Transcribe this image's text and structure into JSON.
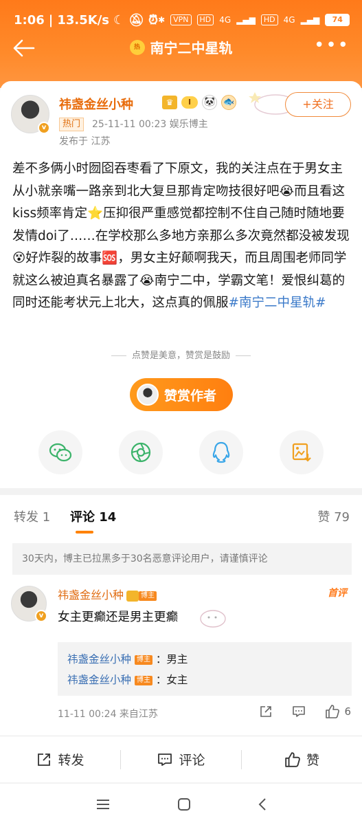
{
  "status_bar": {
    "time": "1:06",
    "speed": "13.5K/s",
    "vpn": "VPN",
    "hd1": "HD",
    "net1": "4G",
    "hd2": "HD",
    "net2": "4G",
    "battery": "74"
  },
  "nav": {
    "title": "南宁二中星轨",
    "topic_badge": "热"
  },
  "post": {
    "author": "祎盏金丝小种",
    "level": "I",
    "hot_tag": "热门",
    "meta": "25-11-11 00:23  娱乐博主",
    "location": "发布于 江苏",
    "follow_label": "+关注",
    "text_main": "差不多俩小时囫囵吞枣看了下原文，我的关注点在于男女主从小就亲嘴一路亲到北大复旦那肯定吻技很好吧😭而且看这kiss频率肯定⭐压抑很严重感觉都控制不住自己随时随地要发情doi了……在学校那么多地方亲那么多次竟然都没被发现😵好炸裂的故事🆘，男女主好颠啊我天，而且周围老师同学就这么被迫真名暴露了😭南宁二中，学霸文笔！爱恨纠葛的同时还能考状元上北大，这点真的佩服",
    "hashtag": "#南宁二中星轨#",
    "reward_note": "点赞是美意，赞赏是鼓励",
    "reward_button": "赞赏作者"
  },
  "share": [
    {
      "name": "wechat-icon"
    },
    {
      "name": "moments-icon"
    },
    {
      "name": "qq-icon"
    },
    {
      "name": "save-image-icon"
    }
  ],
  "tabs": {
    "repost": "转发 1",
    "comment": "评论 14",
    "like": "赞 79"
  },
  "comments": {
    "notice": "30天内，博主已拉黑多于30名恶意评论用户，请谨慎评论",
    "items": [
      {
        "author": "祎盏金丝小种",
        "host_badge": "博主",
        "first_label": "首评",
        "text": "女主更癫还是男主更癫",
        "replies": [
          {
            "who": "祎盏金丝小种",
            "badge": "博主",
            "text": "：男主"
          },
          {
            "who": "祎盏金丝小种",
            "badge": "博主",
            "text": "：女主"
          }
        ],
        "footer": "11-11 00:24  来自江苏",
        "like_count": "6"
      }
    ]
  },
  "bottom_bar": {
    "repost": "转发",
    "comment": "评论",
    "like": "赞"
  },
  "colors": {
    "brand_orange": "#ff8200",
    "link_blue": "#3b7ac9"
  }
}
